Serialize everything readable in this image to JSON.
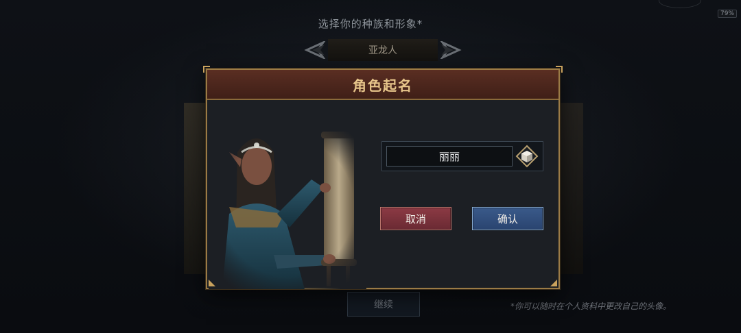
{
  "status": {
    "battery": "79%"
  },
  "header": {
    "title": "选择你的种族和形象*",
    "race_name": "亚龙人",
    "prev_arrow_icon": "chevron-left-icon",
    "next_arrow_icon": "chevron-right-icon"
  },
  "dialog": {
    "title": "角色起名",
    "name_value": "丽丽",
    "dice_icon": "random-dice-icon",
    "cancel_label": "取消",
    "confirm_label": "确认"
  },
  "footer": {
    "continue_label": "继续",
    "note": "*你可以随时在个人资料中更改自己的头像。"
  },
  "colors": {
    "dialog_border": "#9b7b46",
    "header_bg": "#5a2e22",
    "title_gold": "#e6c48a",
    "cancel_red": "#8c3a44",
    "confirm_blue": "#3a5a8a"
  }
}
